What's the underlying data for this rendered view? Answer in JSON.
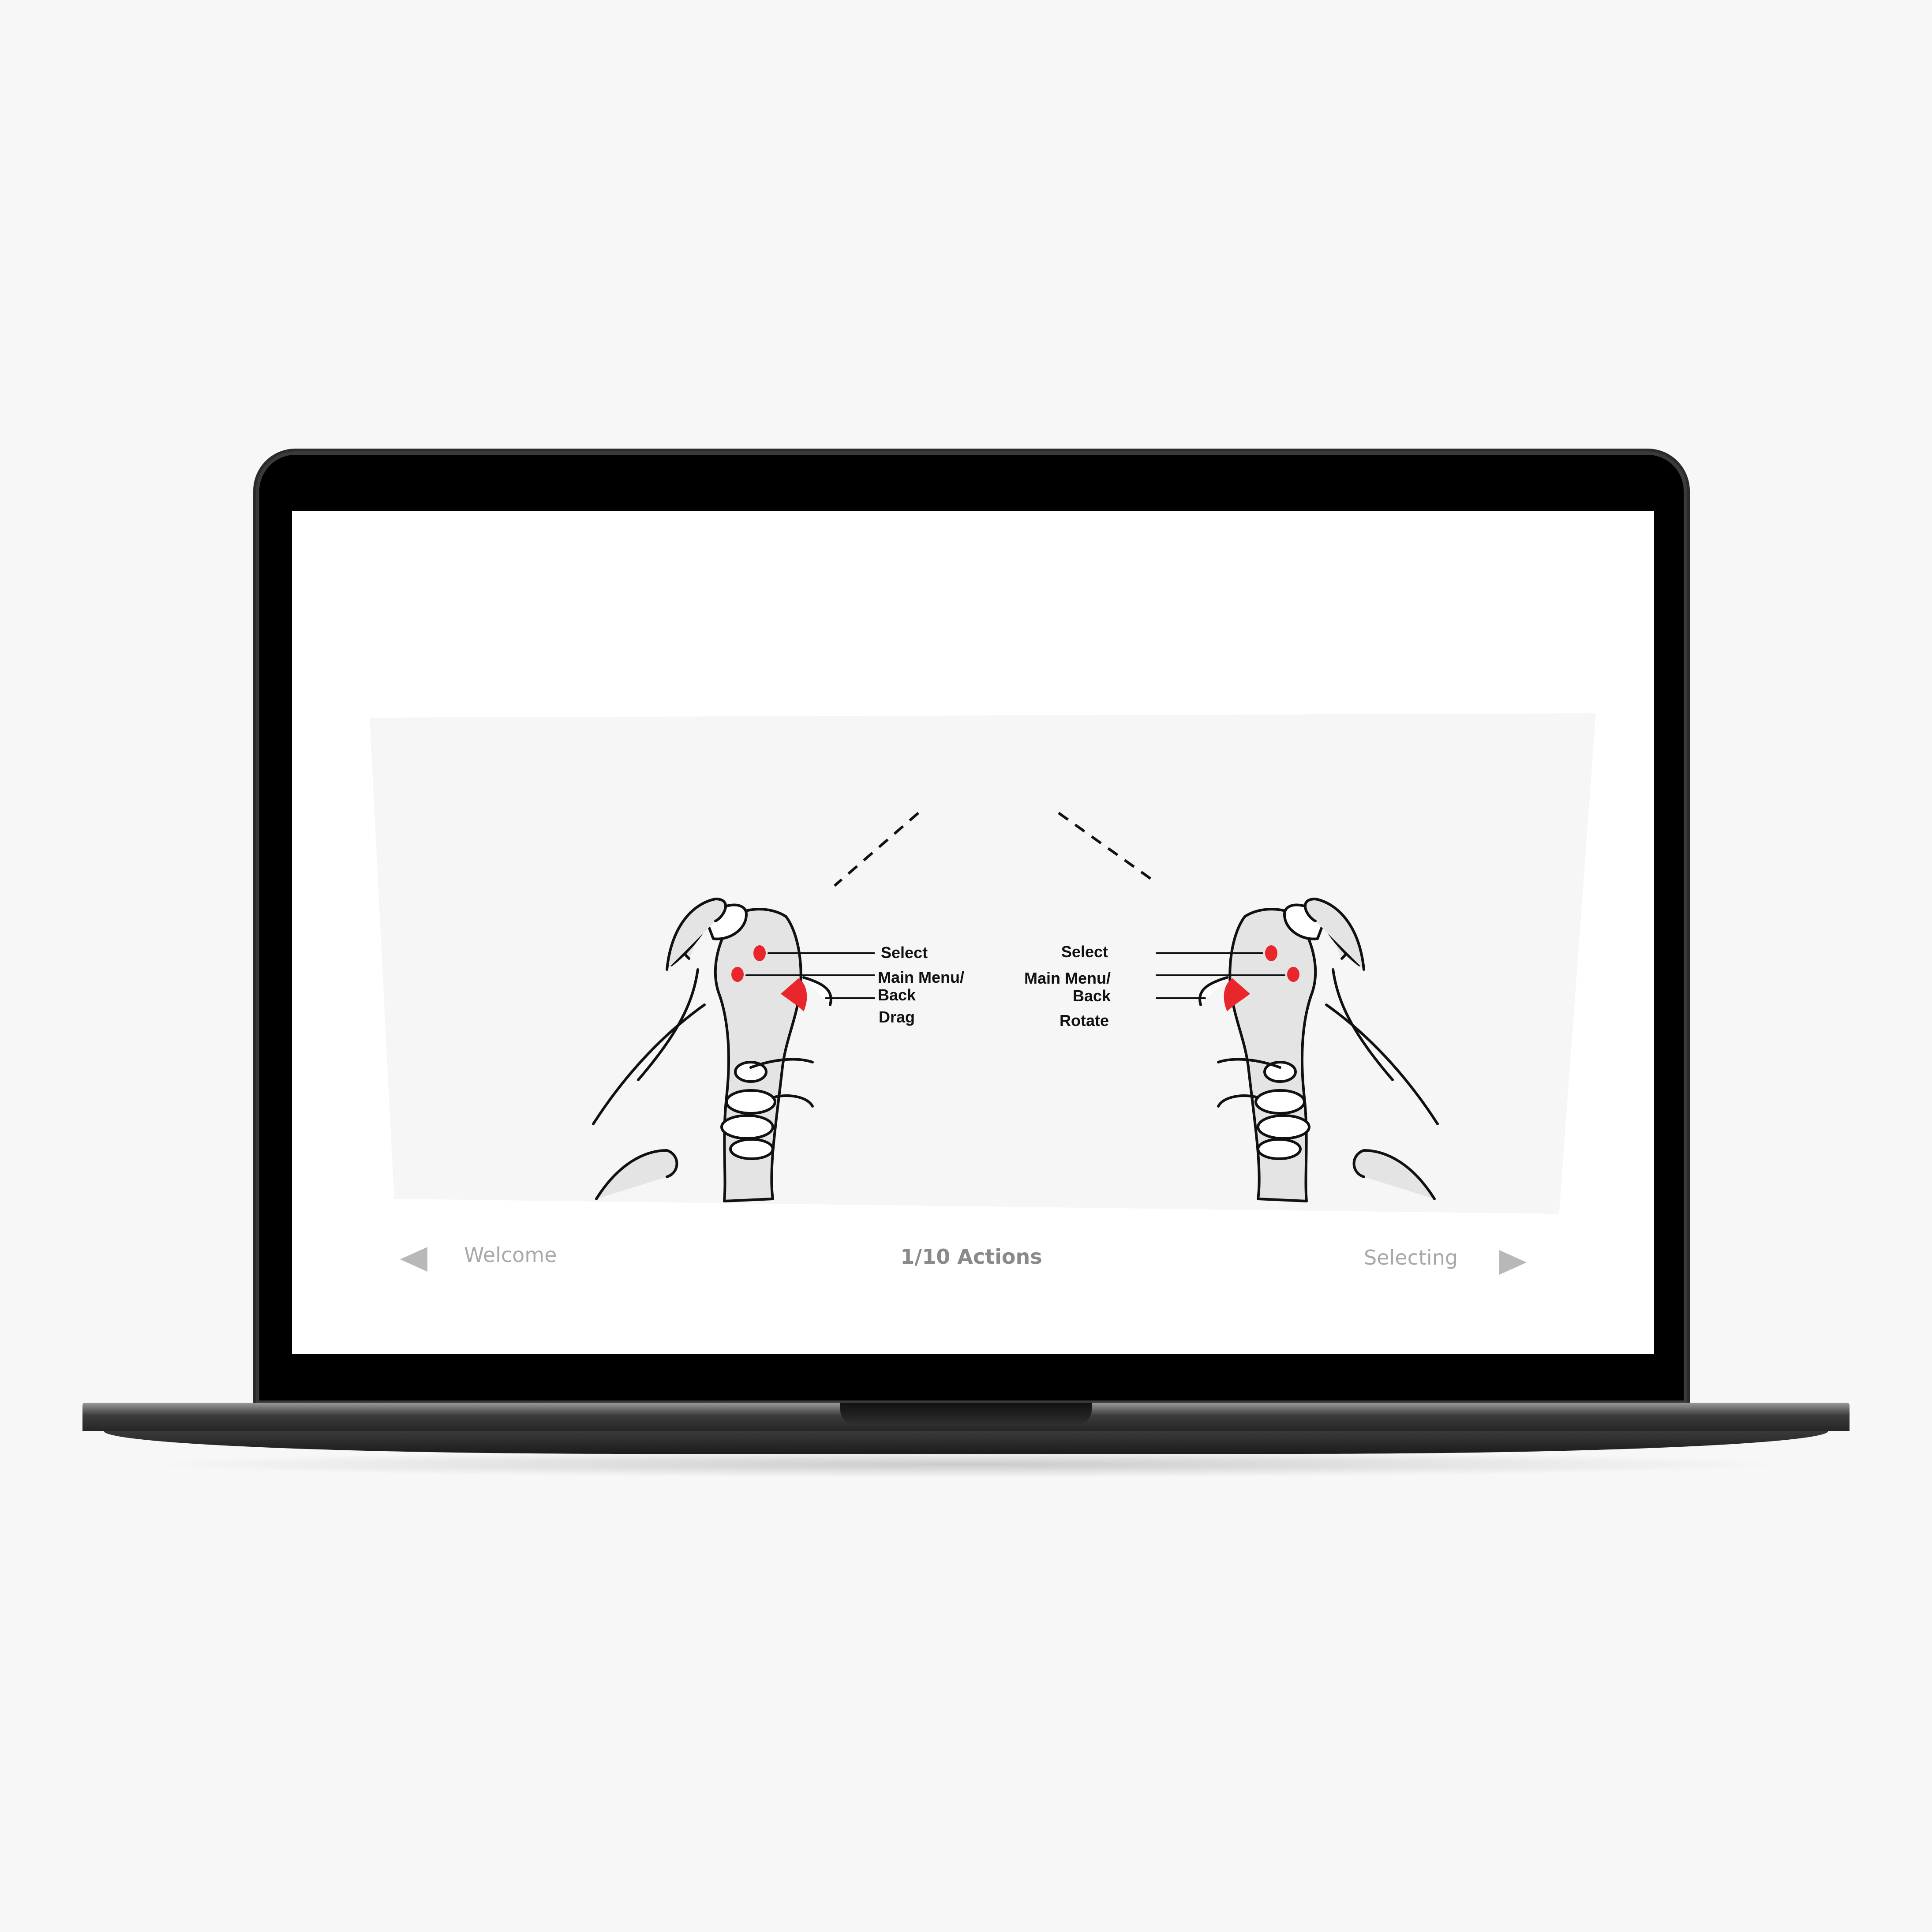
{
  "tutorial": {
    "left_controller": {
      "callouts": [
        {
          "label": "Select"
        },
        {
          "label_line1": "Main Menu/",
          "label_line2": "Back"
        },
        {
          "label": "Drag"
        }
      ]
    },
    "right_controller": {
      "callouts": [
        {
          "label": "Select"
        },
        {
          "label_line1": "Main Menu/",
          "label_line2": "Back"
        },
        {
          "label": "Rotate"
        }
      ]
    },
    "button_highlight_color": "#e8262b",
    "controller_color": "#e4e4e4"
  },
  "navigation": {
    "prev_label": "Welcome",
    "prev_icon": "triangle-left-icon",
    "counter": "1/10 Actions",
    "next_label": "Selecting",
    "next_icon": "triangle-right-icon"
  },
  "device": {
    "frame": "laptop",
    "bezel_color": "#000000",
    "body_color": "#3a3a3a"
  }
}
